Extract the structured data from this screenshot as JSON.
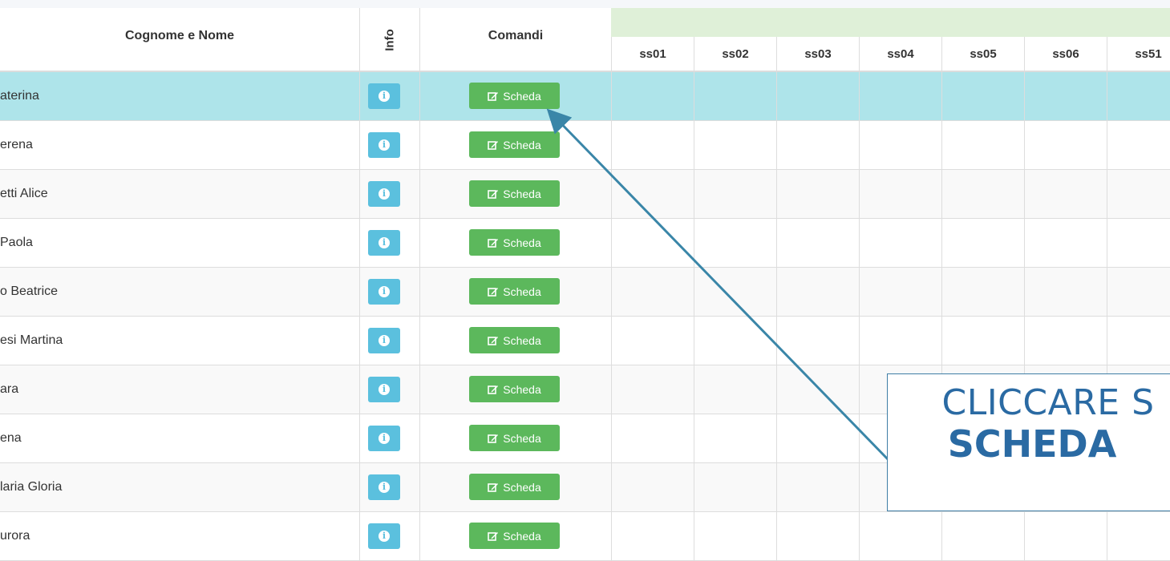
{
  "table": {
    "headers": {
      "name": "Cognome e Nome",
      "info": "Info",
      "commands": "Comandi",
      "sessions": [
        "ss01",
        "ss02",
        "ss03",
        "ss04",
        "ss05",
        "ss06",
        "ss51"
      ]
    },
    "rows": [
      {
        "name": "aterina",
        "active": true
      },
      {
        "name": "erena"
      },
      {
        "name": "etti Alice"
      },
      {
        "name": "Paola"
      },
      {
        "name": "o Beatrice"
      },
      {
        "name": "esi Martina"
      },
      {
        "name": "ara"
      },
      {
        "name": "ena"
      },
      {
        "name": "laria Gloria"
      },
      {
        "name": "urora"
      }
    ],
    "button_label": "Scheda",
    "info_icon": "info-circle-icon",
    "edit_icon": "edit-icon"
  },
  "callout": {
    "line1": "CLICCARE S",
    "line2": "SCHEDA"
  },
  "colors": {
    "active_row": "#aee4ea",
    "info_button": "#5bc0de",
    "scheda_button": "#5cb85c",
    "sessions_band": "#dff0d8",
    "callout": "#2a6aa3"
  }
}
